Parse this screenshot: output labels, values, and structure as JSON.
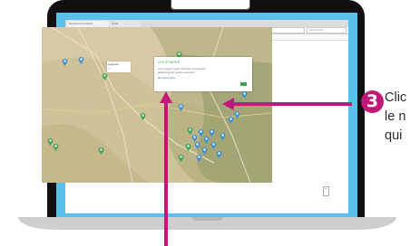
{
  "browser": {
    "tabs": [
      "Découvrir la France",
      "Carte"
    ],
    "url": "www.",
    "search_placeholder": "Rechercher",
    "bookmarks": [
      "Actualités",
      "Favoris",
      "Outils",
      "Aide",
      "Voyages",
      "Cartes",
      "Météo"
    ],
    "nav_back": "◂",
    "nav_forward": "▸",
    "nav_reload": "↻"
  },
  "map": {
    "legend_lines": [
      "Légende",
      "—"
    ],
    "zoom_label": "+",
    "popup": {
      "title": "LES ÉTAPES",
      "lines": [
        "Lorem ipsum dolor sit amet consectetur",
        "adipiscing elit sed do eiusmod"
      ],
      "link": "En savoir plus"
    },
    "pin_colors": {
      "blue": "#3b8fd6",
      "green": "#3aa34f"
    }
  },
  "annotation": {
    "step_number": "3",
    "caption_lines": [
      "Clic",
      "le n",
      "qui"
    ],
    "accent": "#c0197a"
  },
  "colors": {
    "screen_bezel": "#111111",
    "screen_border": "#5bc0ea",
    "map_base": "#d8c9a6"
  }
}
